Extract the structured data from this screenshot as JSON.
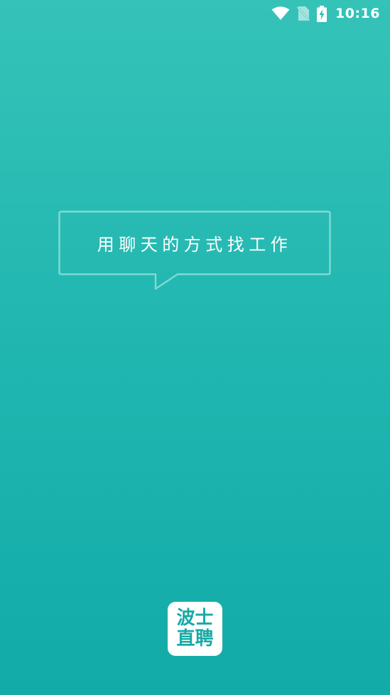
{
  "status_bar": {
    "time": "10:16",
    "icons": [
      "wifi-icon",
      "no-sim-icon",
      "battery-charging-icon"
    ]
  },
  "splash": {
    "slogan": "用聊天的方式找工作"
  },
  "logo": {
    "line1": "波士",
    "line2": "直聘",
    "color": "#17aaa5"
  },
  "colors": {
    "background_top": "#35c3b8",
    "background_bottom": "#12aba8",
    "bubble_border": "#7fd9d1"
  }
}
